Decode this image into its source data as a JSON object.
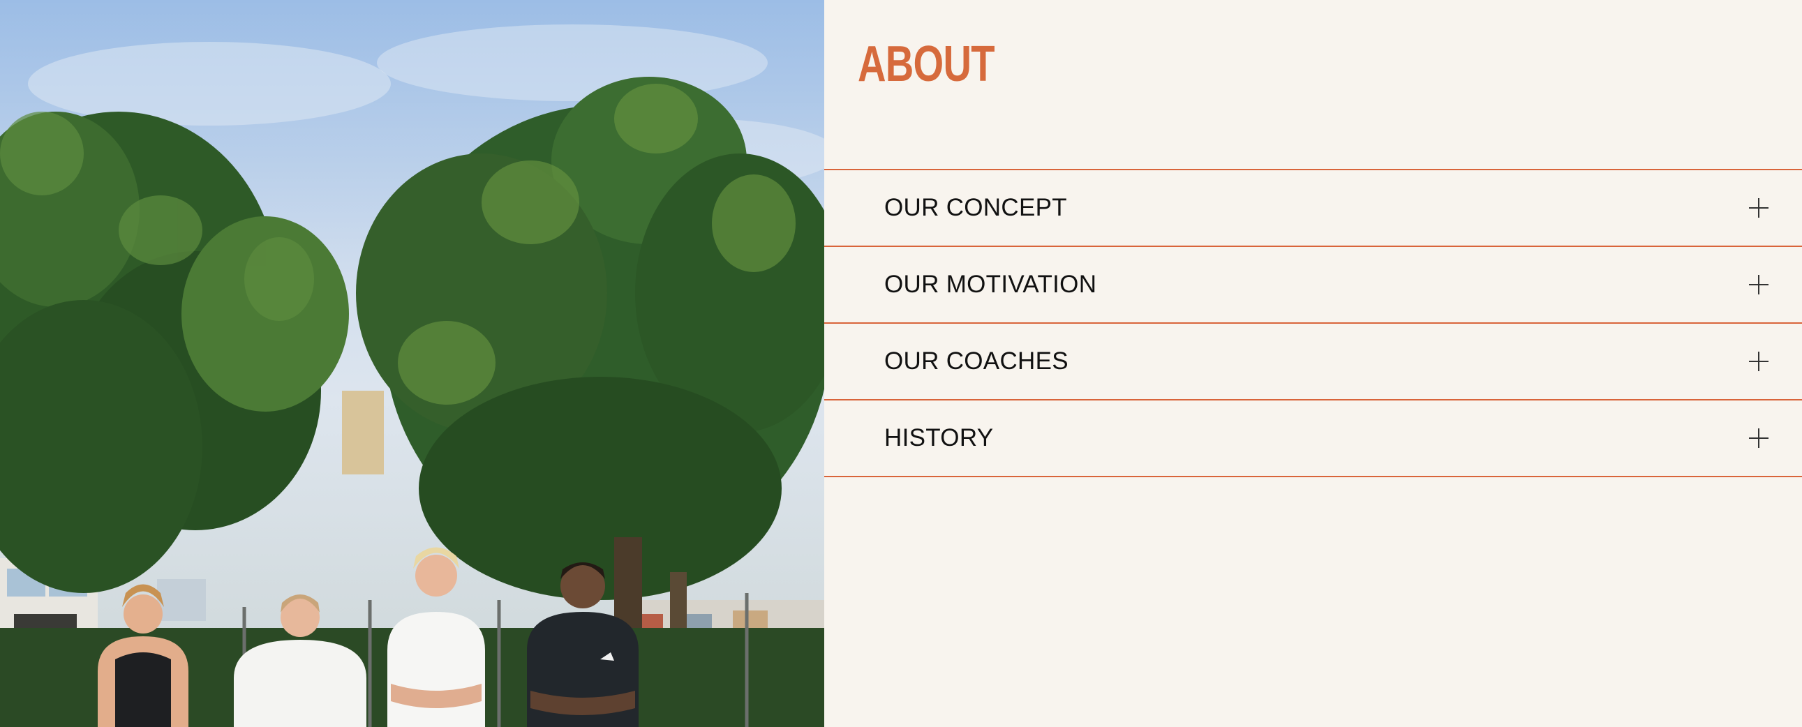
{
  "page": {
    "title": "ABOUT",
    "accent_color": "#d66a3c",
    "background_color": "#f8f4ee"
  },
  "hero_image": {
    "subject": "four coaches standing in front of trees and a fence"
  },
  "accordion": {
    "items": [
      {
        "label": "OUR CONCEPT",
        "icon": "plus-icon",
        "expanded": false
      },
      {
        "label": "OUR MOTIVATION",
        "icon": "plus-icon",
        "expanded": false
      },
      {
        "label": "OUR COACHES",
        "icon": "plus-icon",
        "expanded": false
      },
      {
        "label": "HISTORY",
        "icon": "plus-icon",
        "expanded": false
      }
    ]
  }
}
